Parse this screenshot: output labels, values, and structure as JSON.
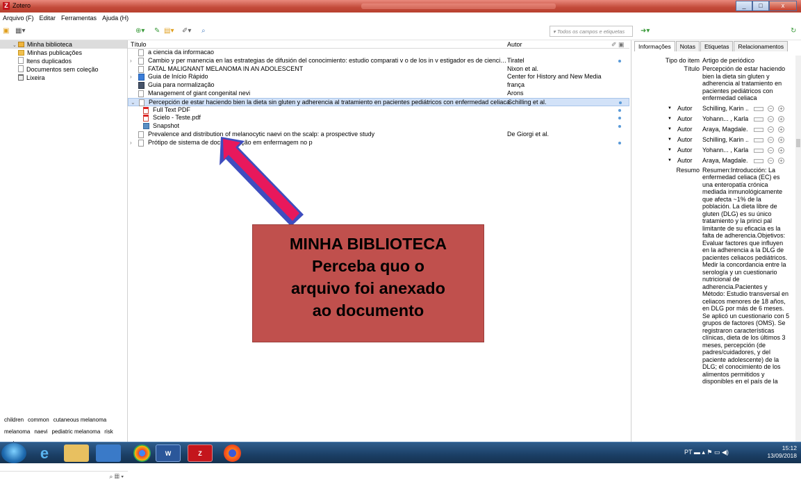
{
  "window": {
    "title": "Zotero",
    "minimize": "_",
    "maximize": "□",
    "close": "x"
  },
  "menu": [
    "Arquivo (F)",
    "Editar",
    "Ferramentas",
    "Ajuda (H)"
  ],
  "search": {
    "placeholder": "▾ Todos os campos e etiquetas"
  },
  "collections": [
    {
      "label": "Minha biblioteca",
      "icon": "library-icon"
    },
    {
      "label": "Minhas publicações",
      "icon": "folder-icon"
    },
    {
      "label": "Itens duplicados",
      "icon": "duplicates-icon"
    },
    {
      "label": "Documentos sem coleção",
      "icon": "folder-icon"
    },
    {
      "label": "Lixeira",
      "icon": "trash-icon"
    }
  ],
  "tags": [
    "children",
    "common",
    "cutaneous melanoma",
    "melanoma",
    "naevi",
    "pediatric melanoma",
    "risk",
    "scalp"
  ],
  "columns": {
    "title": "Título",
    "author": "Autor"
  },
  "items": [
    {
      "title": "a ciencia da informacao",
      "author": "",
      "twisty": "",
      "icon": "doc",
      "dot": false,
      "child": false
    },
    {
      "title": "Cambio y per manencia en las estrategias de difusión del conocimiento: estudio comparati v o de los in v estigador es de ciencias del ...",
      "author": "Tiratel",
      "twisty": "›",
      "icon": "doc",
      "dot": true,
      "child": false
    },
    {
      "title": "FATAL MALIGNANT MELANOMA IN AN ADOLESCENT",
      "author": "Nixon et al.",
      "twisty": "",
      "icon": "doc",
      "dot": false,
      "child": false
    },
    {
      "title": "Guia de Início Rápido",
      "author": "Center for History and New Media",
      "twisty": "›",
      "icon": "book",
      "dot": false,
      "child": false
    },
    {
      "title": "Guia para normalização",
      "author": "frança",
      "twisty": "",
      "icon": "guia",
      "dot": false,
      "child": false
    },
    {
      "title": "Management of giant congenital nevi",
      "author": "Arons",
      "twisty": "",
      "icon": "doc",
      "dot": false,
      "child": false
    },
    {
      "title": "Percepción de estar haciendo bien la dieta sin gluten y adherencia al tratamiento en pacientes pediátricos con enfermedad celiaca",
      "author": "Schilling et al.",
      "twisty": "⌄",
      "icon": "doc",
      "dot": true,
      "child": false,
      "selected": true
    },
    {
      "title": "Full Text PDF",
      "author": "",
      "twisty": "",
      "icon": "pdf",
      "dot": true,
      "child": true
    },
    {
      "title": "Scielo - Teste.pdf",
      "author": "",
      "twisty": "",
      "icon": "pdf",
      "dot": true,
      "child": true
    },
    {
      "title": "Snapshot",
      "author": "",
      "twisty": "",
      "icon": "snap",
      "dot": true,
      "child": true
    },
    {
      "title": "Prevalence and distribution of melanocytic naevi on the scalp: a prospective study",
      "author": "De Giorgi et al.",
      "twisty": "",
      "icon": "doc",
      "dot": false,
      "child": false
    },
    {
      "title": "Prótipo de sistema de documentação em enfermagem no p",
      "author": "",
      "twisty": "›",
      "icon": "doc",
      "dot": true,
      "child": false
    }
  ],
  "tabs": [
    "Informações",
    "Notas",
    "Etiquetas",
    "Relacionamentos"
  ],
  "info": {
    "type_label": "Tipo do item",
    "type_value": "Artigo de periódico",
    "title_label": "Título",
    "title_value": "Percepción de estar haciendo bien la dieta sin gluten y adherencia al tratamiento en pacientes pediátricos con enfermedad celiaca",
    "author_label": "Autor",
    "authors": [
      "Schilling, Karin ...",
      "Yohann... , Karla",
      "Araya, Magdale...",
      "Schilling, Karin ...",
      "Yohann... , Karla",
      "Araya, Magdale..."
    ],
    "abstract_label": "Resumo",
    "abstract_value": "Resumen:Introducción: La enfermedad celiaca (EC) es una enteropatía crónica mediada inmunológicamente que afecta ~1% de la población. La dieta libre de gluten (DLG) es su único tratamiento y la princi pal limitante de su eficacia es la falta de adherencia.Objetivos: Evaluar factores que influyen en la adherencia a la DLG de pacientes celiacos pediátricos. Medir la concordancia entre la serología y un cuestionario nutricional de adherencia.Pacientes y Método: Estudio transversal en celiacos menores de 18 años, en DLG por más de 6 meses. Se aplicó un cuestionario con 5 grupos de factores (OMS). Se registraron características clínicas, dieta de los últimos 3 meses, percepción (de padres/cuidadores, y del paciente adolescente) de la DLG; el conocimiento de los alimentos permitidos y disponibles en el país de la"
  },
  "callout": {
    "line1": "MINHA BIBLIOTECA",
    "line2": "Perceba quo o",
    "line3": "arquivo foi anexado",
    "line4": "ao documento"
  },
  "taskbar": {
    "lang": "PT",
    "time": "15:12",
    "date": "13/09/2018"
  }
}
